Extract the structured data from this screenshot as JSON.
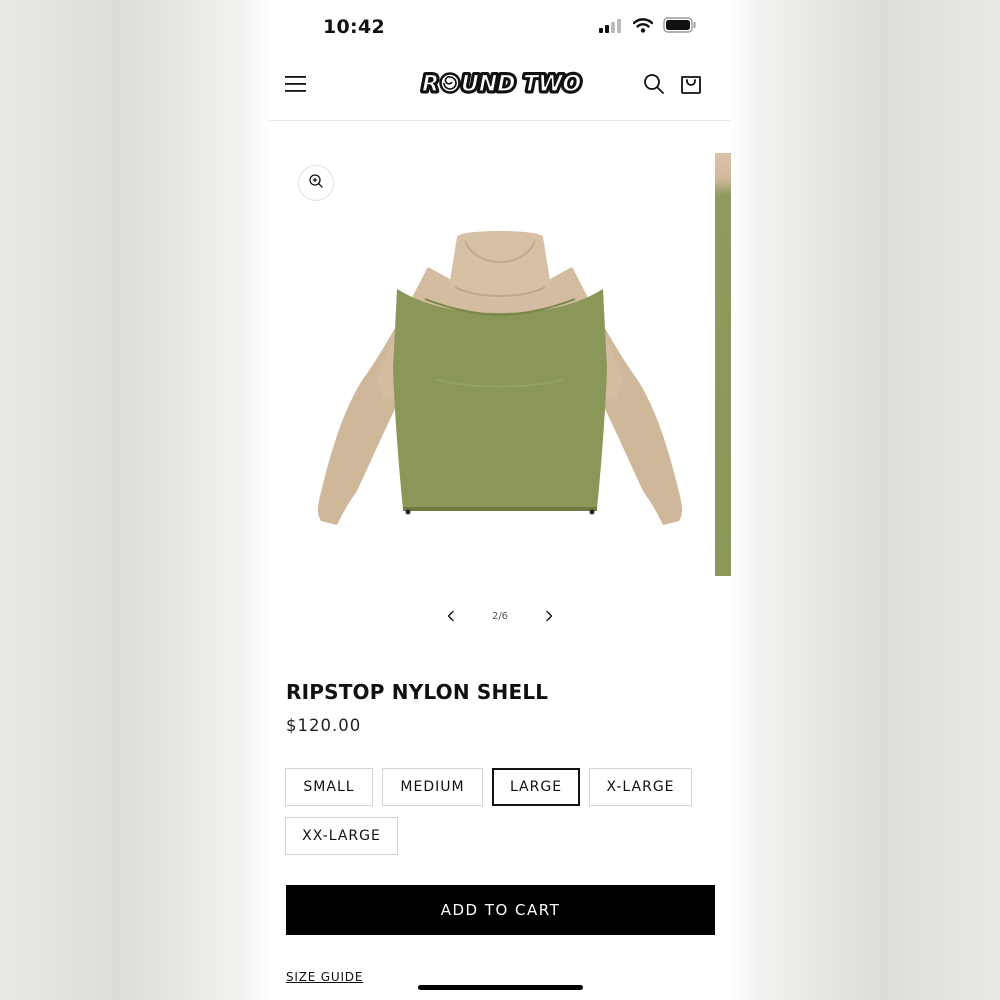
{
  "status_bar": {
    "time": "10:42"
  },
  "header": {
    "logo_text": "ROUND TWO",
    "menu_icon": "menu-icon",
    "search_icon": "search-icon",
    "cart_icon": "cart-icon"
  },
  "gallery": {
    "current": "2",
    "total": "6",
    "counter": "2/6",
    "zoom_icon": "zoom-in-icon",
    "prev_icon": "chevron-left-icon",
    "next_icon": "chevron-right-icon"
  },
  "product": {
    "title": "RIPSTOP NYLON SHELL",
    "price": "$120.00",
    "sizes": [
      "SMALL",
      "MEDIUM",
      "LARGE",
      "X-LARGE",
      "XX-LARGE"
    ],
    "selected_size": "LARGE"
  },
  "actions": {
    "add_to_cart": "ADD TO CART",
    "size_guide": "SIZE GUIDE"
  },
  "colors": {
    "accent": "#000000",
    "jacket_body": "#8a9759",
    "jacket_sleeves": "#d3bca0"
  }
}
